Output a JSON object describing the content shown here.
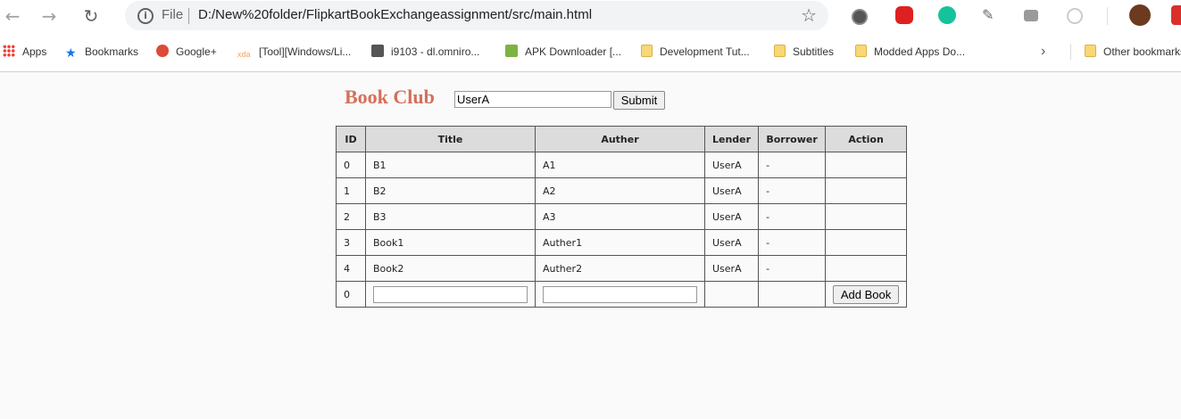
{
  "browser": {
    "tab_scheme_label": "File",
    "url": "D:/New%20folder/FlipkartBookExchangeassignment/src/main.html",
    "bookmarks": [
      {
        "label": "Apps",
        "icon": "apps-grid-icon"
      },
      {
        "label": "Bookmarks",
        "icon": "star-icon"
      },
      {
        "label": "Google+",
        "icon": "google-plus-icon"
      },
      {
        "label": "[Tool][Windows/Li...",
        "icon": "xda-icon"
      },
      {
        "label": "i9103 - dl.omniro...",
        "icon": "folder-icon"
      },
      {
        "label": "APK Downloader [...",
        "icon": "image-icon"
      },
      {
        "label": "Development Tut...",
        "icon": "folder-icon"
      },
      {
        "label": "Subtitles",
        "icon": "folder-icon"
      },
      {
        "label": "Modded Apps Do...",
        "icon": "folder-icon"
      },
      {
        "label": "Other bookmarks",
        "icon": "folder-icon"
      }
    ],
    "colors": {
      "accent": "#d4705a"
    }
  },
  "page": {
    "brand": "Book Club",
    "user_value": "UserA",
    "submit_label": "Submit"
  },
  "table": {
    "headers": [
      "ID",
      "Title",
      "Auther",
      "Lender",
      "Borrower",
      "Action"
    ],
    "rows": [
      {
        "id": "0",
        "title": "B1",
        "auther": "A1",
        "lender": "UserA",
        "borrower": "-",
        "action": ""
      },
      {
        "id": "1",
        "title": "B2",
        "auther": "A2",
        "lender": "UserA",
        "borrower": "-",
        "action": ""
      },
      {
        "id": "2",
        "title": "B3",
        "auther": "A3",
        "lender": "UserA",
        "borrower": "-",
        "action": ""
      },
      {
        "id": "3",
        "title": "Book1",
        "auther": "Auther1",
        "lender": "UserA",
        "borrower": "-",
        "action": ""
      },
      {
        "id": "4",
        "title": "Book2",
        "auther": "Auther2",
        "lender": "UserA",
        "borrower": "-",
        "action": ""
      }
    ],
    "new_row": {
      "id": "0",
      "title_value": "",
      "auther_value": "",
      "add_label": "Add Book"
    }
  }
}
